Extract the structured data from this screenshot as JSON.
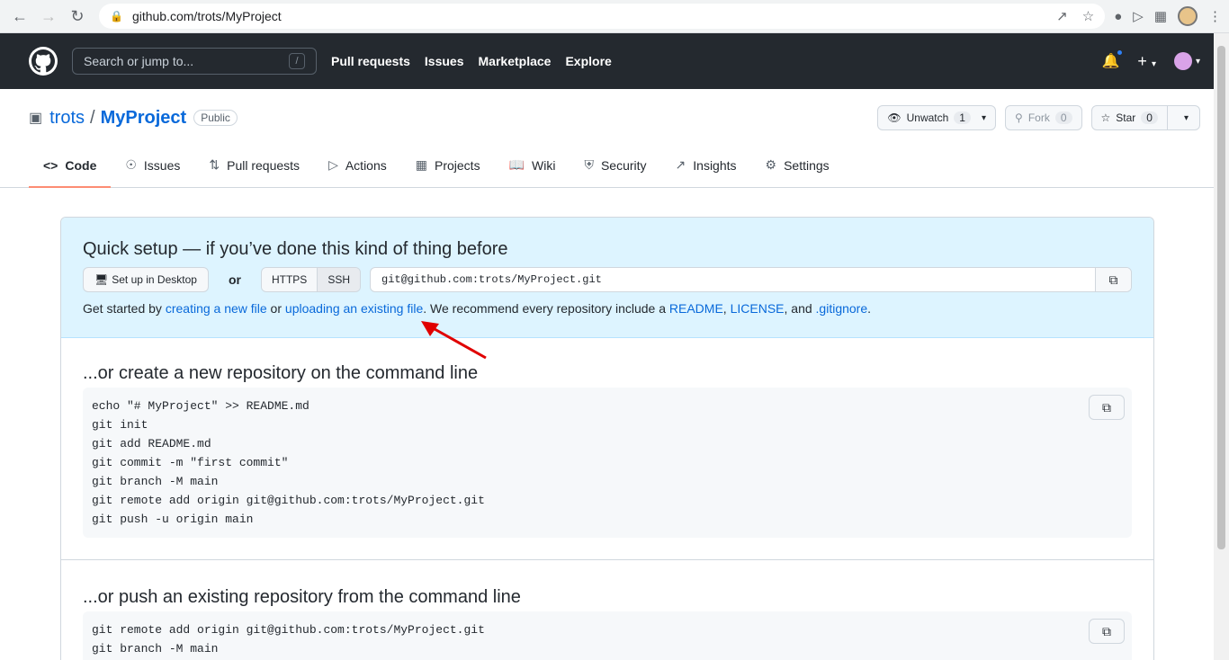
{
  "browser": {
    "url": "github.com/trots/MyProject"
  },
  "header": {
    "search_placeholder": "Search or jump to...",
    "search_key": "/",
    "nav": [
      "Pull requests",
      "Issues",
      "Marketplace",
      "Explore"
    ],
    "plus": "+"
  },
  "repo": {
    "owner": "trots",
    "separator": "/",
    "name": "MyProject",
    "visibility": "Public",
    "watch": {
      "label": "Unwatch",
      "count": "1"
    },
    "fork": {
      "label": "Fork",
      "count": "0"
    },
    "star": {
      "label": "Star",
      "count": "0"
    }
  },
  "tabs": [
    {
      "label": "Code",
      "icon": "code-icon"
    },
    {
      "label": "Issues",
      "icon": "issue-icon"
    },
    {
      "label": "Pull requests",
      "icon": "pull-request-icon"
    },
    {
      "label": "Actions",
      "icon": "play-icon"
    },
    {
      "label": "Projects",
      "icon": "table-icon"
    },
    {
      "label": "Wiki",
      "icon": "book-icon"
    },
    {
      "label": "Security",
      "icon": "shield-icon"
    },
    {
      "label": "Insights",
      "icon": "graph-icon"
    },
    {
      "label": "Settings",
      "icon": "gear-icon"
    }
  ],
  "quick": {
    "title": "Quick setup — if you’ve done this kind of thing before",
    "desktop": "Set up in Desktop",
    "or": "or",
    "https": "HTTPS",
    "ssh": "SSH",
    "clone_url": "git@github.com:trots/MyProject.git",
    "help": {
      "t1": "Get started by ",
      "link1": "creating a new file",
      "t2": " or ",
      "link2": "uploading an existing file",
      "t3": ". We recommend every repository include a ",
      "link3": "README",
      "t4": ", ",
      "link4": "LICENSE",
      "t5": ", and ",
      "link5": ".gitignore",
      "t6": "."
    }
  },
  "new_repo": {
    "title": "...or create a new repository on the command line",
    "code": "echo \"# MyProject\" >> README.md\ngit init\ngit add README.md\ngit commit -m \"first commit\"\ngit branch -M main\ngit remote add origin git@github.com:trots/MyProject.git\ngit push -u origin main"
  },
  "push_repo": {
    "title": "...or push an existing repository from the command line",
    "code": "git remote add origin git@github.com:trots/MyProject.git\ngit branch -M main"
  },
  "colors": {
    "header_bg": "#24292f",
    "link": "#0969da",
    "quick_bg": "#ddf4ff",
    "active_tab": "#fd8c73",
    "annotation_arrow": "#e00000"
  }
}
